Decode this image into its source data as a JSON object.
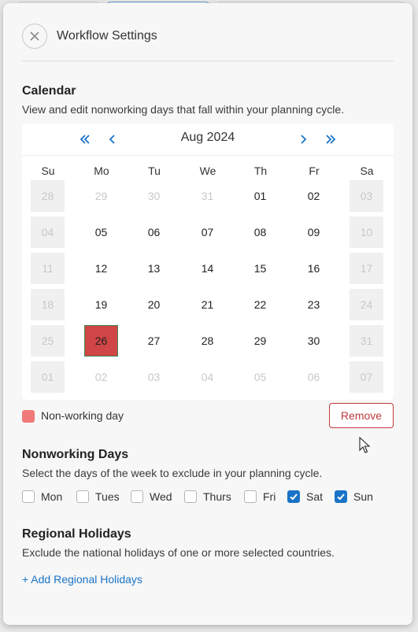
{
  "header": {
    "title": "Workflow Settings"
  },
  "calendar_section": {
    "title": "Calendar",
    "description": "View and edit nonworking days that fall within your planning cycle.",
    "month_label": "Aug 2024",
    "weekday_headers": [
      "Su",
      "Mo",
      "Tu",
      "We",
      "Th",
      "Fr",
      "Sa"
    ],
    "weeks": [
      [
        {
          "d": "28",
          "m": true,
          "w": true
        },
        {
          "d": "29",
          "m": true
        },
        {
          "d": "30",
          "m": true
        },
        {
          "d": "31",
          "m": true
        },
        {
          "d": "01"
        },
        {
          "d": "02"
        },
        {
          "d": "03",
          "m": true,
          "w": true
        }
      ],
      [
        {
          "d": "04",
          "m": true,
          "w": true
        },
        {
          "d": "05"
        },
        {
          "d": "06"
        },
        {
          "d": "07"
        },
        {
          "d": "08"
        },
        {
          "d": "09"
        },
        {
          "d": "10",
          "m": true,
          "w": true
        }
      ],
      [
        {
          "d": "11",
          "m": true,
          "w": true
        },
        {
          "d": "12"
        },
        {
          "d": "13"
        },
        {
          "d": "14"
        },
        {
          "d": "15"
        },
        {
          "d": "16"
        },
        {
          "d": "17",
          "m": true,
          "w": true
        }
      ],
      [
        {
          "d": "18",
          "m": true,
          "w": true
        },
        {
          "d": "19"
        },
        {
          "d": "20"
        },
        {
          "d": "21"
        },
        {
          "d": "22"
        },
        {
          "d": "23"
        },
        {
          "d": "24",
          "m": true,
          "w": true
        }
      ],
      [
        {
          "d": "25",
          "m": true,
          "w": true
        },
        {
          "d": "26",
          "s": true
        },
        {
          "d": "27"
        },
        {
          "d": "28"
        },
        {
          "d": "29"
        },
        {
          "d": "30"
        },
        {
          "d": "31",
          "m": true,
          "w": true
        }
      ],
      [
        {
          "d": "01",
          "m": true,
          "w": true
        },
        {
          "d": "02",
          "m": true
        },
        {
          "d": "03",
          "m": true
        },
        {
          "d": "04",
          "m": true
        },
        {
          "d": "05",
          "m": true
        },
        {
          "d": "06",
          "m": true
        },
        {
          "d": "07",
          "m": true,
          "w": true
        }
      ]
    ],
    "legend_label": "Non-working day",
    "legend_color": "#f07a7a",
    "remove_label": "Remove"
  },
  "nonworking_section": {
    "title": "Nonworking Days",
    "description": "Select the days of the week to exclude in your planning cycle.",
    "days": [
      {
        "label": "Mon",
        "checked": false
      },
      {
        "label": "Tues",
        "checked": false
      },
      {
        "label": "Wed",
        "checked": false
      },
      {
        "label": "Thurs",
        "checked": false
      },
      {
        "label": "Fri",
        "checked": false
      },
      {
        "label": "Sat",
        "checked": true
      },
      {
        "label": "Sun",
        "checked": true
      }
    ]
  },
  "holidays_section": {
    "title": "Regional Holidays",
    "description": "Exclude the national holidays of one or more selected countries.",
    "add_link": "+ Add Regional Holidays"
  },
  "colors": {
    "accent": "#1a73c7",
    "danger": "#c0393b",
    "selected_day": "#d04545"
  },
  "icons": {
    "close": "close-icon",
    "first": "double-chevron-left-icon",
    "prev": "chevron-left-icon",
    "next": "chevron-right-icon",
    "last": "double-chevron-right-icon",
    "check": "checkmark-icon"
  }
}
